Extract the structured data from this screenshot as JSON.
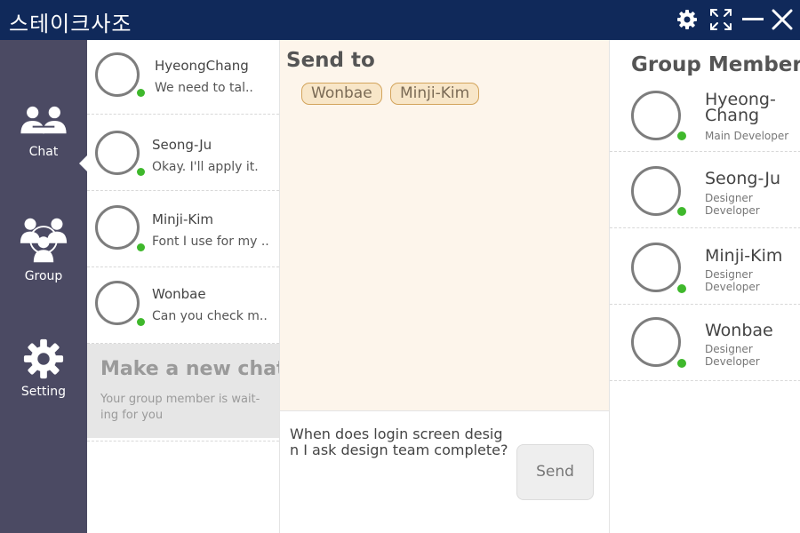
{
  "app": {
    "title": "스테이크사조"
  },
  "window_controls": [
    {
      "name": "settings",
      "icon": "gear-icon"
    },
    {
      "name": "fullscreen",
      "icon": "fullscreen-icon"
    },
    {
      "name": "minimize",
      "icon": "minimize-icon"
    },
    {
      "name": "close",
      "icon": "close-icon"
    }
  ],
  "nav": {
    "active": "Chat",
    "items": [
      {
        "label": "Chat",
        "icon": "chat-people-icon"
      },
      {
        "label": "Group",
        "icon": "group-people-icon"
      },
      {
        "label": "Setting",
        "icon": "gear-icon"
      }
    ]
  },
  "chats": [
    {
      "name": "HyeongChang",
      "preview": "We need to tal..",
      "online": true
    },
    {
      "name": "Seong-Ju",
      "preview": "Okay. I'll apply it.",
      "online": true
    },
    {
      "name": "Minji-Kim",
      "preview": "Font I use for my ..",
      "online": true
    },
    {
      "name": "Wonbae",
      "preview": "Can you check m..",
      "online": true
    }
  ],
  "new_chat": {
    "title": "Make a new chat",
    "subtitle": "Your group member is wait-ing for you"
  },
  "send_to": {
    "title": "Send to",
    "recipients": [
      "Wonbae",
      "Minji-Kim"
    ]
  },
  "compose": {
    "text": "When does login screen design I ask design team complete?",
    "send_label": "Send"
  },
  "group_members": {
    "title": "Group Member",
    "members": [
      {
        "name": "Hyeong-Chang",
        "role": "Main Developer",
        "online": true
      },
      {
        "name": "Seong-Ju",
        "role": "Designer Developer",
        "online": true
      },
      {
        "name": "Minji-Kim",
        "role": "Designer Developer",
        "online": true
      },
      {
        "name": "Wonbae",
        "role": "Designer Developer",
        "online": true
      }
    ]
  },
  "colors": {
    "titlebar": "#10295a",
    "nav": "#4b4a63",
    "message_bg": "#fdf5eb",
    "chip_bg": "#f8e6c8",
    "chip_border": "#d3a45c",
    "online": "#3fb82c"
  }
}
